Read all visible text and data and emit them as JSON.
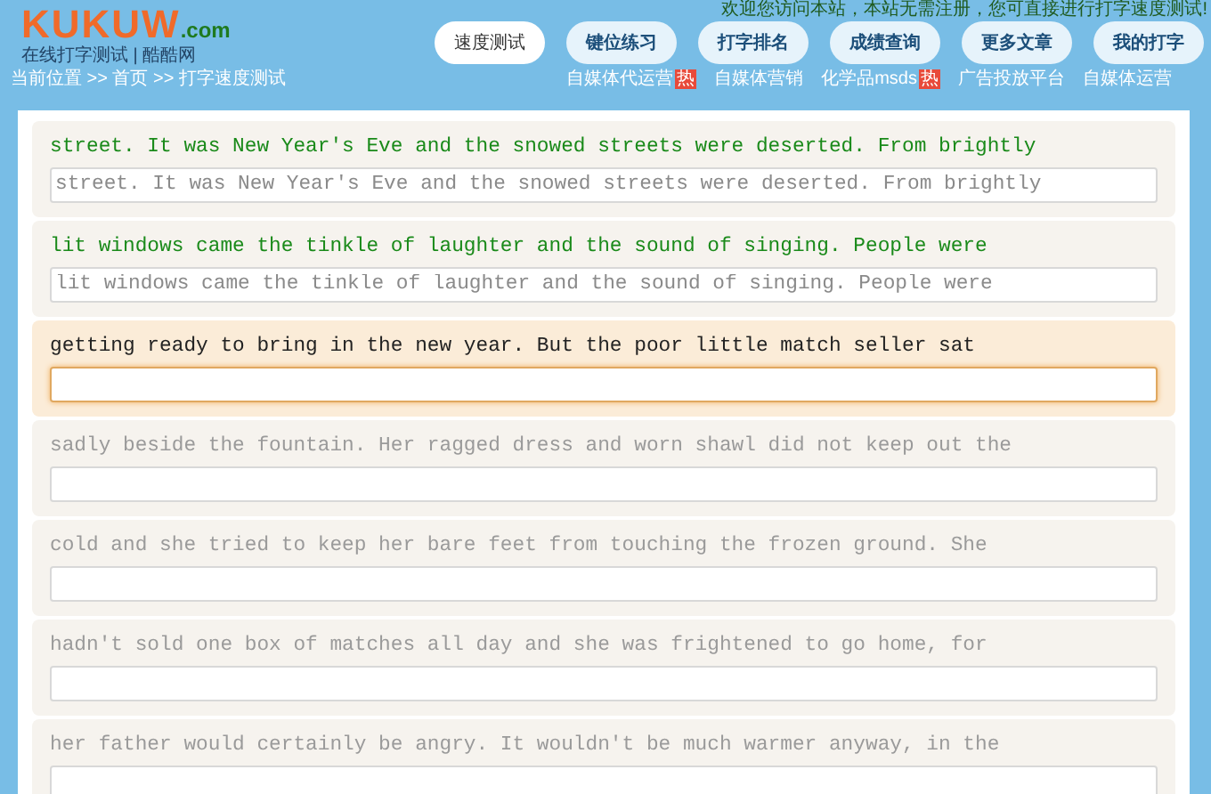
{
  "header": {
    "logo": "KUKUW",
    "logo_suffix": ".com",
    "tagline": "在线打字测试 | 酷酷网",
    "greeting": "欢迎您访问本站，本站无需注册，您可直接进行打字速度测试!",
    "nav": [
      {
        "label": "速度测试",
        "selected": true
      },
      {
        "label": "键位练习",
        "selected": false
      },
      {
        "label": "打字排名",
        "selected": false
      },
      {
        "label": "成绩查询",
        "selected": false
      },
      {
        "label": "更多文章",
        "selected": false
      },
      {
        "label": "我的打字",
        "selected": false
      }
    ],
    "breadcrumb": "当前位置 >> 首页 >> 打字速度测试",
    "links": [
      {
        "label": "自媒体代运营",
        "badge": "热"
      },
      {
        "label": "自媒体营销"
      },
      {
        "label": "化学品msds",
        "badge": "热"
      },
      {
        "label": "广告投放平台"
      },
      {
        "label": "自媒体运营"
      }
    ]
  },
  "lines": [
    {
      "kind": "done",
      "text": "street. It was New Year's Eve and the snowed streets were deserted. From brightly",
      "typed": "street. It was New Year's Eve and the snowed streets were deserted. From brightly"
    },
    {
      "kind": "done",
      "text": "lit windows came the tinkle of laughter and the sound of singing. People were",
      "typed": "lit windows came the tinkle of laughter and the sound of singing. People were"
    },
    {
      "kind": "current",
      "text": "getting ready to bring in the new year. But the poor little match seller sat"
    },
    {
      "kind": "pending",
      "text": "sadly beside the fountain. Her ragged dress and worn shawl did not keep out the"
    },
    {
      "kind": "pending",
      "text": "cold and she tried to keep her bare feet from touching the frozen ground. She"
    },
    {
      "kind": "pending",
      "text": "hadn't sold one box of matches all day and she was frightened to go home, for"
    },
    {
      "kind": "pending",
      "text": "her father would certainly be angry. It wouldn't be much warmer anyway, in the"
    }
  ]
}
